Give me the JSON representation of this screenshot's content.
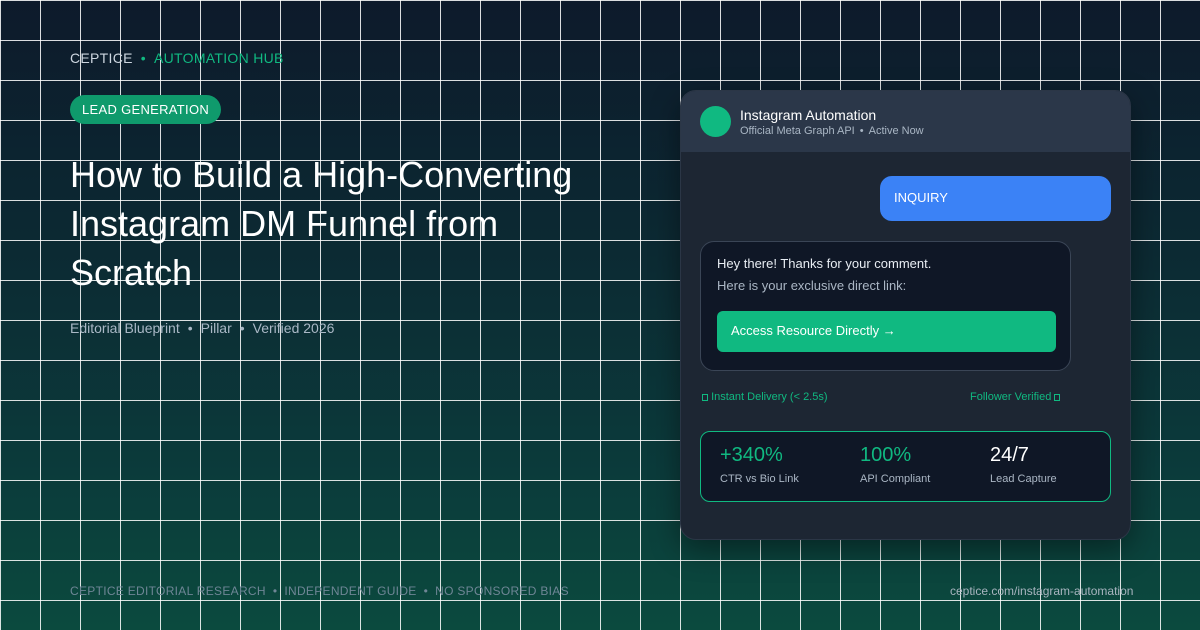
{
  "brand": {
    "name": "CEPTICE",
    "separator": "•",
    "hub": "AUTOMATION HUB"
  },
  "tag": "LEAD GENERATION",
  "title": "How to Build a High-Converting Instagram DM Funnel from Scratch",
  "meta": {
    "type": "Editorial Blueprint",
    "category": "Pillar",
    "status": "Verified 2026",
    "separator": "•"
  },
  "card": {
    "header": {
      "title": "Instagram Automation",
      "api": "Official Meta Graph API",
      "status": "Active Now",
      "separator": "•"
    },
    "outgoing_message": "INQUIRY",
    "reply": {
      "line1": "Hey there! Thanks for your comment.",
      "line2": "Here is your exclusive direct link:",
      "cta": "Access Resource Directly →"
    },
    "status_left": "Instant Delivery (< 2.5s)",
    "status_right": "Follower Verified",
    "stats": [
      {
        "value": "+340%",
        "label": "CTR vs Bio Link"
      },
      {
        "value": "100%",
        "label": "API Compliant"
      },
      {
        "value": "24/7",
        "label": "Lead Capture"
      }
    ]
  },
  "footer": {
    "items": [
      "CEPTICE EDITORIAL RESEARCH",
      "INDEPENDENT GUIDE",
      "NO SPONSORED BIAS"
    ],
    "separator": "•",
    "url": "ceptice.com/instagram-automation"
  },
  "colors": {
    "accent": "#10b981",
    "message_blue": "#3b82f6",
    "card_bg": "#1d2633"
  }
}
